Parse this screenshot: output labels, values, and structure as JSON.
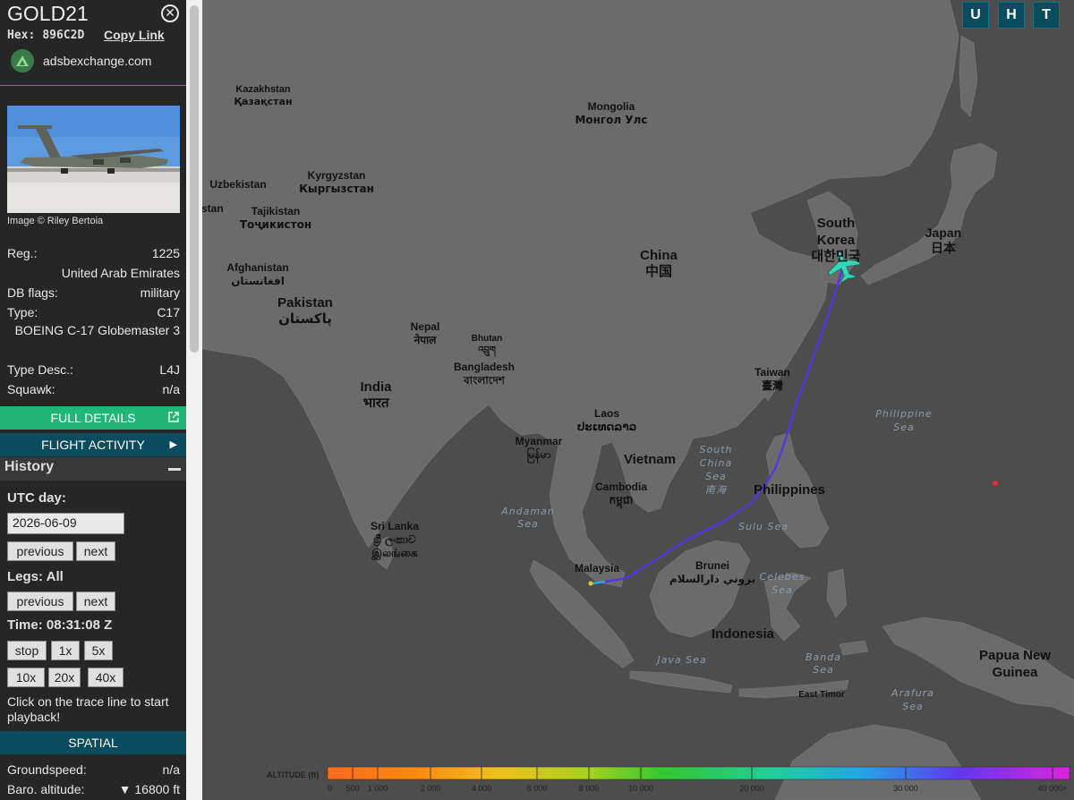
{
  "sidebar": {
    "callsign": "GOLD21",
    "close_glyph": "✕",
    "hex_label": "Hex:",
    "hex_value": "896C2D",
    "copy_link": "Copy Link",
    "site": "adsbexchange.com",
    "photo_credit": "Image © Riley Bertoia",
    "fields": [
      {
        "k": "Reg.:",
        "v": "1225"
      },
      {
        "k": "",
        "v": "United Arab Emirates"
      },
      {
        "k": "DB flags:",
        "v": "military"
      },
      {
        "k": "Type:",
        "v": "C17"
      },
      {
        "k": "",
        "v": "BOEING C-17 Globemaster 3"
      },
      {
        "k": "Type Desc.:",
        "v": "L4J"
      },
      {
        "k": "Squawk:",
        "v": "n/a"
      }
    ],
    "full_details": "FULL DETAILS",
    "flight_activity": "FLIGHT ACTIVITY",
    "history_title": "History",
    "utc_day_label": "UTC day:",
    "date_value": "2026-06-09",
    "prev_label": "previous",
    "next_label": "next",
    "legs_label": "Legs: All",
    "time_label": "Time: 08:31:08 Z",
    "speed_buttons": [
      "stop",
      "1x",
      "5x",
      "10x",
      "20x",
      "40x"
    ],
    "hint": "Click on the trace line to start playback!",
    "spatial": "SPATIAL",
    "groundspeed_label": "Groundspeed:",
    "groundspeed_value": "n/a",
    "baro_label": "Baro. altitude:",
    "baro_value": "▼ 16800 ft"
  },
  "map": {
    "buttons": [
      "U",
      "H",
      "T"
    ],
    "countries": [
      {
        "name": "Kazakhstan",
        "local": "Қазақстан"
      },
      {
        "name": "Mongolia",
        "local": "Монгол Улс"
      },
      {
        "name": "Kyrgyzstan",
        "local": "Кыргызстан"
      },
      {
        "name": "Uzbekistan",
        "local": ""
      },
      {
        "name": "nistan",
        "local": ""
      },
      {
        "name": "Tajikistan",
        "local": "Тоҷикистон"
      },
      {
        "name": "Afghanistan",
        "local": "افغانستان"
      },
      {
        "name": "Pakistan",
        "local": "پاکستان"
      },
      {
        "name": "China",
        "local": "中国"
      },
      {
        "name": "South",
        "local": ""
      },
      {
        "name": "Korea",
        "local": "대한민국"
      },
      {
        "name": "Japan",
        "local": "日本"
      },
      {
        "name": "Nepal",
        "local": "नेपाल"
      },
      {
        "name": "Bhutan",
        "local": "འབྲུག"
      },
      {
        "name": "Bangladesh",
        "local": "বাংলাদেশ"
      },
      {
        "name": "India",
        "local": "भारत"
      },
      {
        "name": "Taiwan",
        "local": "臺灣"
      },
      {
        "name": "Laos",
        "local": "ປະເທດລາວ"
      },
      {
        "name": "Myanmar",
        "local": "မြန်မာ"
      },
      {
        "name": "Vietnam",
        "local": ""
      },
      {
        "name": "Cambodia",
        "local": "កម្ពុជា"
      },
      {
        "name": "Philippines",
        "local": ""
      },
      {
        "name": "Sri Lanka",
        "local": "ශ්‍රී ලංකාව"
      },
      {
        "name": "",
        "local": "இலங்கை"
      },
      {
        "name": "Malaysia",
        "local": ""
      },
      {
        "name": "Brunei",
        "local": "بروني دارالسلام"
      },
      {
        "name": "Indonesia",
        "local": ""
      },
      {
        "name": "East Timor",
        "local": ""
      },
      {
        "name": "Papua New",
        "local": ""
      },
      {
        "name": "Guinea",
        "local": ""
      }
    ],
    "seas": [
      "Philippine",
      "Sea",
      "South",
      "China",
      "Sea",
      "南海",
      "Andaman",
      "Sea",
      "Sulu Sea",
      "Celebes",
      "Sea",
      "Java Sea",
      "Banda",
      "Sea",
      "Arafura",
      "Sea"
    ],
    "legend": {
      "title": "ALTITUDE (ft)",
      "ticks": [
        "0",
        "500",
        "1 000",
        "2 000",
        "4 000",
        "6 000",
        "8 000",
        "10 000",
        "20 000",
        "30 000",
        "40 000+"
      ]
    },
    "colors": {
      "track": "#5533ee",
      "aircraft": "#35d6b6",
      "land": "#6b6b6b",
      "water": "#4d4d4d"
    }
  }
}
